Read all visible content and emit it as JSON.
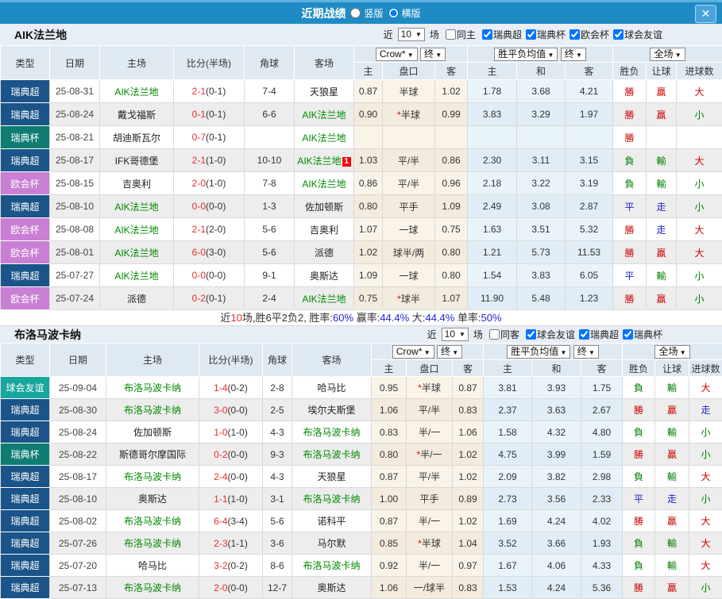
{
  "titlebar": {
    "title": "近期战绩",
    "layout_options": [
      "竖版",
      "横版"
    ],
    "layout_selected": "横版",
    "close_glyph": "✕"
  },
  "table_header": {
    "type": "类型",
    "date": "日期",
    "home": "主场",
    "score": "比分(半场)",
    "corner": "角球",
    "away": "客场",
    "odds_source": "Crow*",
    "odds_final": "终",
    "avg_group": "胜平负均值",
    "avg_final": "终",
    "result_group": "全场",
    "odds_home": "主",
    "odds_handicap": "盘口",
    "odds_away": "客",
    "avg_home": "主",
    "avg_draw": "和",
    "avg_away": "客",
    "wdl": "胜负",
    "handicap_result": "让球",
    "goals": "进球数"
  },
  "colors": {
    "league": {
      "瑞典超": "#1a5488",
      "瑞典杯": "#0f7c72",
      "欧会杯": "#c97fd4",
      "球会友谊": "#17a79c"
    },
    "result": {
      "勝": "#cc0000",
      "負": "#008000",
      "平": "#2222cc",
      "贏": "#cc0000",
      "輸": "#008000",
      "走": "#2222cc",
      "大": "#cc0000",
      "小": "#008000"
    },
    "focus_team": "#008800",
    "score_ft": "#e83030",
    "bar": "#1f8bc4"
  },
  "sections": [
    {
      "team": "AIK法兰地",
      "filter": {
        "near_label": "近",
        "count": "10",
        "unit_label": "场",
        "same_label": "同主",
        "same_checked": false,
        "leagues": [
          "瑞典超",
          "瑞典杯",
          "欧会杯",
          "球会友谊"
        ]
      },
      "rows": [
        {
          "league": "瑞典超",
          "date": "25-08-31",
          "home": "AIK法兰地",
          "home_focus": true,
          "score_ft": "2-1",
          "score_ht": "(0-1)",
          "corner": "7-4",
          "away": "天狼星",
          "away_focus": false,
          "away_badge": "",
          "odds_home": "0.87",
          "handicap": "半球",
          "odds_away": "1.02",
          "avg_home": "1.78",
          "avg_draw": "3.68",
          "avg_away": "4.21",
          "result": "勝",
          "handicap_result": "贏",
          "goals_result": "大"
        },
        {
          "league": "瑞典超",
          "date": "25-08-24",
          "home": "戴戈福斯",
          "home_focus": false,
          "score_ft": "0-1",
          "score_ht": "(0-1)",
          "corner": "6-6",
          "away": "AIK法兰地",
          "away_focus": true,
          "away_badge": "",
          "odds_home": "0.90",
          "handicap": "*半球",
          "odds_away": "0.99",
          "avg_home": "3.83",
          "avg_draw": "3.29",
          "avg_away": "1.97",
          "result": "勝",
          "handicap_result": "贏",
          "goals_result": "小"
        },
        {
          "league": "瑞典杯",
          "date": "25-08-21",
          "home": "胡迪斯瓦尔",
          "home_focus": false,
          "score_ft": "0-7",
          "score_ht": "(0-1)",
          "corner": "",
          "away": "AIK法兰地",
          "away_focus": true,
          "away_badge": "",
          "odds_home": "",
          "handicap": "",
          "odds_away": "",
          "avg_home": "",
          "avg_draw": "",
          "avg_away": "",
          "result": "勝",
          "handicap_result": "",
          "goals_result": ""
        },
        {
          "league": "瑞典超",
          "date": "25-08-17",
          "home": "IFK哥德堡",
          "home_focus": false,
          "score_ft": "2-1",
          "score_ht": "(1-0)",
          "corner": "10-10",
          "away": "AIK法兰地",
          "away_focus": true,
          "away_badge": "1",
          "odds_home": "1.03",
          "handicap": "平/半",
          "odds_away": "0.86",
          "avg_home": "2.30",
          "avg_draw": "3.11",
          "avg_away": "3.15",
          "result": "負",
          "handicap_result": "輸",
          "goals_result": "大"
        },
        {
          "league": "欧会杯",
          "date": "25-08-15",
          "home": "吉奥利",
          "home_focus": false,
          "score_ft": "2-0",
          "score_ht": "(1-0)",
          "corner": "7-8",
          "away": "AIK法兰地",
          "away_focus": true,
          "away_badge": "",
          "odds_home": "0.86",
          "handicap": "平/半",
          "odds_away": "0.96",
          "avg_home": "2.18",
          "avg_draw": "3.22",
          "avg_away": "3.19",
          "result": "負",
          "handicap_result": "輸",
          "goals_result": "小"
        },
        {
          "league": "瑞典超",
          "date": "25-08-10",
          "home": "AIK法兰地",
          "home_focus": true,
          "score_ft": "0-0",
          "score_ht": "(0-0)",
          "corner": "1-3",
          "away": "佐加顿斯",
          "away_focus": false,
          "away_badge": "",
          "odds_home": "0.80",
          "handicap": "平手",
          "odds_away": "1.09",
          "avg_home": "2.49",
          "avg_draw": "3.08",
          "avg_away": "2.87",
          "result": "平",
          "handicap_result": "走",
          "goals_result": "小"
        },
        {
          "league": "欧会杯",
          "date": "25-08-08",
          "home": "AIK法兰地",
          "home_focus": true,
          "score_ft": "2-1",
          "score_ht": "(2-0)",
          "corner": "5-6",
          "away": "吉奥利",
          "away_focus": false,
          "away_badge": "",
          "odds_home": "1.07",
          "handicap": "一球",
          "odds_away": "0.75",
          "avg_home": "1.63",
          "avg_draw": "3.51",
          "avg_away": "5.32",
          "result": "勝",
          "handicap_result": "走",
          "goals_result": "大"
        },
        {
          "league": "欧会杯",
          "date": "25-08-01",
          "home": "AIK法兰地",
          "home_focus": true,
          "score_ft": "6-0",
          "score_ht": "(3-0)",
          "corner": "5-6",
          "away": "派德",
          "away_focus": false,
          "away_badge": "",
          "odds_home": "1.02",
          "handicap": "球半/两",
          "odds_away": "0.80",
          "avg_home": "1.21",
          "avg_draw": "5.73",
          "avg_away": "11.53",
          "result": "勝",
          "handicap_result": "贏",
          "goals_result": "大"
        },
        {
          "league": "瑞典超",
          "date": "25-07-27",
          "home": "AIK法兰地",
          "home_focus": true,
          "score_ft": "0-0",
          "score_ht": "(0-0)",
          "corner": "9-1",
          "away": "奥斯达",
          "away_focus": false,
          "away_badge": "",
          "odds_home": "1.09",
          "handicap": "一球",
          "odds_away": "0.80",
          "avg_home": "1.54",
          "avg_draw": "3.83",
          "avg_away": "6.05",
          "result": "平",
          "handicap_result": "輸",
          "goals_result": "小"
        },
        {
          "league": "欧会杯",
          "date": "25-07-24",
          "home": "派德",
          "home_focus": false,
          "score_ft": "0-2",
          "score_ht": "(0-1)",
          "corner": "2-4",
          "away": "AIK法兰地",
          "away_focus": true,
          "away_badge": "",
          "odds_home": "0.75",
          "handicap": "*球半",
          "odds_away": "1.07",
          "avg_home": "11.90",
          "avg_draw": "5.48",
          "avg_away": "1.23",
          "result": "勝",
          "handicap_result": "贏",
          "goals_result": "小"
        }
      ],
      "summary": {
        "prefix": "近",
        "count": "10",
        "middle": "场,胜6平2负2, 胜率:",
        "win_rate": "60%",
        "label_win": " 赢率:",
        "win_pct": "44.4%",
        "label_big": " 大:",
        "big_pct": "44.4%",
        "label_single": " 单率:",
        "single_pct": "50%"
      }
    },
    {
      "team": "布洛马波卡纳",
      "filter": {
        "near_label": "近",
        "count": "10",
        "unit_label": "场",
        "same_label": "同客",
        "same_checked": false,
        "leagues": [
          "球会友谊",
          "瑞典超",
          "瑞典杯"
        ]
      },
      "rows": [
        {
          "league": "球会友谊",
          "date": "25-09-04",
          "home": "布洛马波卡纳",
          "home_focus": true,
          "score_ft": "1-4",
          "score_ht": "(0-2)",
          "corner": "2-8",
          "away": "哈马比",
          "away_focus": false,
          "away_badge": "",
          "odds_home": "0.95",
          "handicap": "*半球",
          "odds_away": "0.87",
          "avg_home": "3.81",
          "avg_draw": "3.93",
          "avg_away": "1.75",
          "result": "負",
          "handicap_result": "輸",
          "goals_result": "大"
        },
        {
          "league": "瑞典超",
          "date": "25-08-30",
          "home": "布洛马波卡纳",
          "home_focus": true,
          "score_ft": "3-0",
          "score_ht": "(0-0)",
          "corner": "2-5",
          "away": "埃尔夫斯堡",
          "away_focus": false,
          "away_badge": "",
          "odds_home": "1.06",
          "handicap": "平/半",
          "odds_away": "0.83",
          "avg_home": "2.37",
          "avg_draw": "3.63",
          "avg_away": "2.67",
          "result": "勝",
          "handicap_result": "贏",
          "goals_result": "走"
        },
        {
          "league": "瑞典超",
          "date": "25-08-24",
          "home": "佐加顿斯",
          "home_focus": false,
          "score_ft": "1-0",
          "score_ht": "(1-0)",
          "corner": "4-3",
          "away": "布洛马波卡纳",
          "away_focus": true,
          "away_badge": "",
          "odds_home": "0.83",
          "handicap": "半/一",
          "odds_away": "1.06",
          "avg_home": "1.58",
          "avg_draw": "4.32",
          "avg_away": "4.80",
          "result": "負",
          "handicap_result": "輸",
          "goals_result": "小"
        },
        {
          "league": "瑞典杯",
          "date": "25-08-22",
          "home": "斯德哥尔摩国际",
          "home_focus": false,
          "score_ft": "0-2",
          "score_ht": "(0-0)",
          "corner": "9-3",
          "away": "布洛马波卡纳",
          "away_focus": true,
          "away_badge": "",
          "odds_home": "0.80",
          "handicap": "*半/一",
          "odds_away": "1.02",
          "avg_home": "4.75",
          "avg_draw": "3.99",
          "avg_away": "1.59",
          "result": "勝",
          "handicap_result": "贏",
          "goals_result": "小"
        },
        {
          "league": "瑞典超",
          "date": "25-08-17",
          "home": "布洛马波卡纳",
          "home_focus": true,
          "score_ft": "2-4",
          "score_ht": "(0-0)",
          "corner": "4-3",
          "away": "天狼星",
          "away_focus": false,
          "away_badge": "",
          "odds_home": "0.87",
          "handicap": "平/半",
          "odds_away": "1.02",
          "avg_home": "2.09",
          "avg_draw": "3.82",
          "avg_away": "2.98",
          "result": "負",
          "handicap_result": "輸",
          "goals_result": "大"
        },
        {
          "league": "瑞典超",
          "date": "25-08-10",
          "home": "奥斯达",
          "home_focus": false,
          "score_ft": "1-1",
          "score_ht": "(1-0)",
          "corner": "3-1",
          "away": "布洛马波卡纳",
          "away_focus": true,
          "away_badge": "",
          "odds_home": "1.00",
          "handicap": "平手",
          "odds_away": "0.89",
          "avg_home": "2.73",
          "avg_draw": "3.56",
          "avg_away": "2.33",
          "result": "平",
          "handicap_result": "走",
          "goals_result": "小"
        },
        {
          "league": "瑞典超",
          "date": "25-08-02",
          "home": "布洛马波卡纳",
          "home_focus": true,
          "score_ft": "6-4",
          "score_ht": "(3-4)",
          "corner": "5-6",
          "away": "诺科平",
          "away_focus": false,
          "away_badge": "",
          "odds_home": "0.87",
          "handicap": "半/一",
          "odds_away": "1.02",
          "avg_home": "1.69",
          "avg_draw": "4.24",
          "avg_away": "4.02",
          "result": "勝",
          "handicap_result": "贏",
          "goals_result": "大"
        },
        {
          "league": "瑞典超",
          "date": "25-07-26",
          "home": "布洛马波卡纳",
          "home_focus": true,
          "score_ft": "2-3",
          "score_ht": "(1-1)",
          "corner": "3-6",
          "away": "马尔默",
          "away_focus": false,
          "away_badge": "",
          "odds_home": "0.85",
          "handicap": "*半球",
          "odds_away": "1.04",
          "avg_home": "3.52",
          "avg_draw": "3.66",
          "avg_away": "1.93",
          "result": "負",
          "handicap_result": "輸",
          "goals_result": "大"
        },
        {
          "league": "瑞典超",
          "date": "25-07-20",
          "home": "哈马比",
          "home_focus": false,
          "score_ft": "3-2",
          "score_ht": "(0-2)",
          "corner": "8-6",
          "away": "布洛马波卡纳",
          "away_focus": true,
          "away_badge": "",
          "odds_home": "0.92",
          "handicap": "半/一",
          "odds_away": "0.97",
          "avg_home": "1.67",
          "avg_draw": "4.06",
          "avg_away": "4.33",
          "result": "負",
          "handicap_result": "輸",
          "goals_result": "大"
        },
        {
          "league": "瑞典超",
          "date": "25-07-13",
          "home": "布洛马波卡纳",
          "home_focus": true,
          "score_ft": "2-0",
          "score_ht": "(0-0)",
          "corner": "12-7",
          "away": "奥斯达",
          "away_focus": false,
          "away_badge": "",
          "odds_home": "1.06",
          "handicap": "一/球半",
          "odds_away": "0.83",
          "avg_home": "1.53",
          "avg_draw": "4.24",
          "avg_away": "5.36",
          "result": "勝",
          "handicap_result": "贏",
          "goals_result": "小"
        }
      ],
      "summary": null
    }
  ]
}
